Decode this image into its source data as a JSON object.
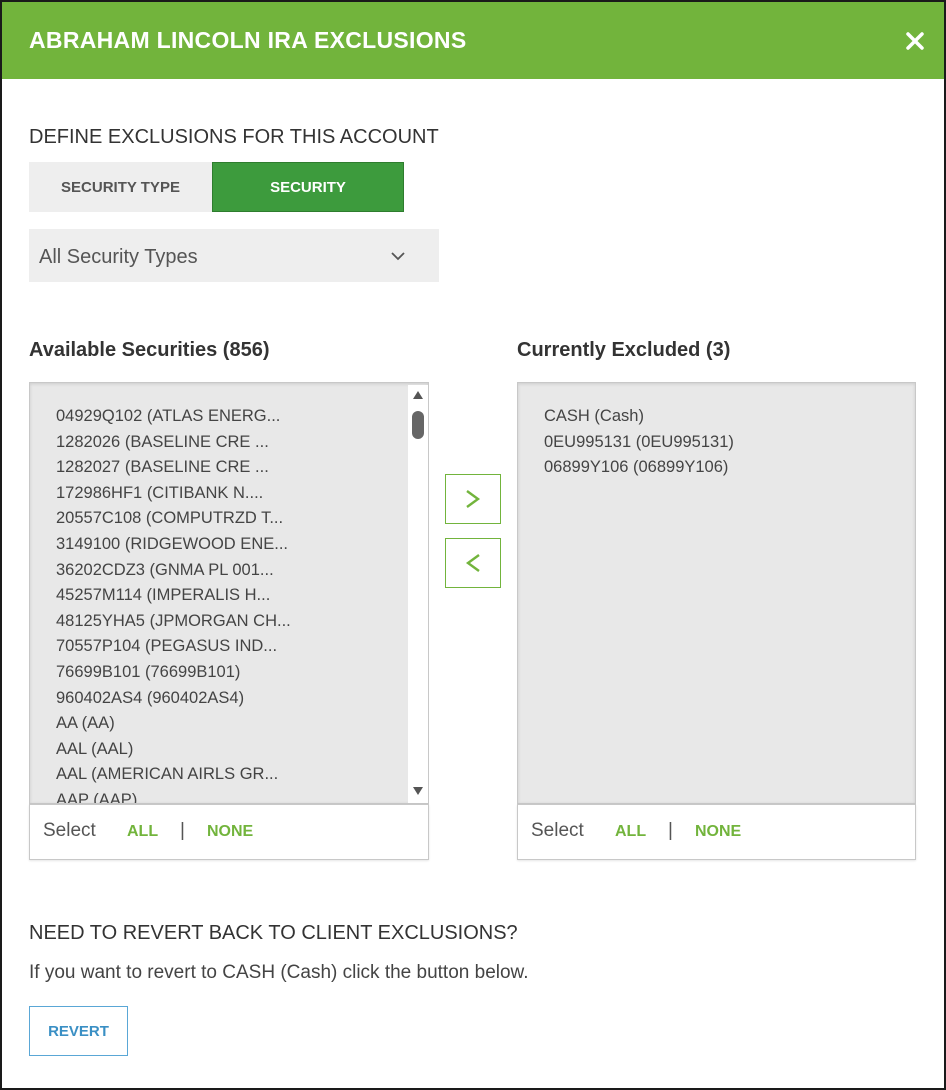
{
  "header": {
    "title": "ABRAHAM LINCOLN IRA EXCLUSIONS",
    "close_icon": "close-icon"
  },
  "define": {
    "title": "DEFINE EXCLUSIONS FOR THIS ACCOUNT",
    "toggle": {
      "security_type_label": "SECURITY TYPE",
      "security_label": "SECURITY",
      "active": "SECURITY"
    },
    "type_select": {
      "value": "All Security Types",
      "icon": "chevron-down-icon"
    }
  },
  "available": {
    "heading": "Available Securities (856)",
    "items": [
      "04929Q102 (ATLAS ENERG...",
      "1282026 (BASELINE CRE ...",
      "1282027 (BASELINE CRE ...",
      "172986HF1 (CITIBANK N....",
      "20557C108 (COMPUTRZD T...",
      "3149100 (RIDGEWOOD ENE...",
      "36202CDZ3 (GNMA PL 001...",
      "45257M114 (IMPERALIS H...",
      "48125YHA5 (JPMORGAN CH...",
      "70557P104 (PEGASUS IND...",
      "76699B101 (76699B101)",
      "960402AS4 (960402AS4)",
      "AA (AA)",
      "AAL (AAL)",
      "AAL (AMERICAN AIRLS GR...",
      "AAP (AAP)"
    ],
    "select": {
      "label": "Select",
      "all": "ALL",
      "separator": "|",
      "none": "NONE"
    }
  },
  "excluded": {
    "heading": "Currently Excluded (3)",
    "items": [
      "CASH (Cash)",
      "0EU995131 (0EU995131)",
      "06899Y106 (06899Y106)"
    ],
    "select": {
      "label": "Select",
      "all": "ALL",
      "separator": "|",
      "none": "NONE"
    }
  },
  "move": {
    "right_label": ">",
    "left_label": "<"
  },
  "revert": {
    "title": "NEED TO REVERT BACK TO CLIENT EXCLUSIONS?",
    "description": "If you want to revert to CASH (Cash) click the button below.",
    "button_label": "REVERT"
  },
  "colors": {
    "brand_green": "#72b43c",
    "active_toggle": "#3d9b3d",
    "revert_blue": "#3a8fc4"
  }
}
